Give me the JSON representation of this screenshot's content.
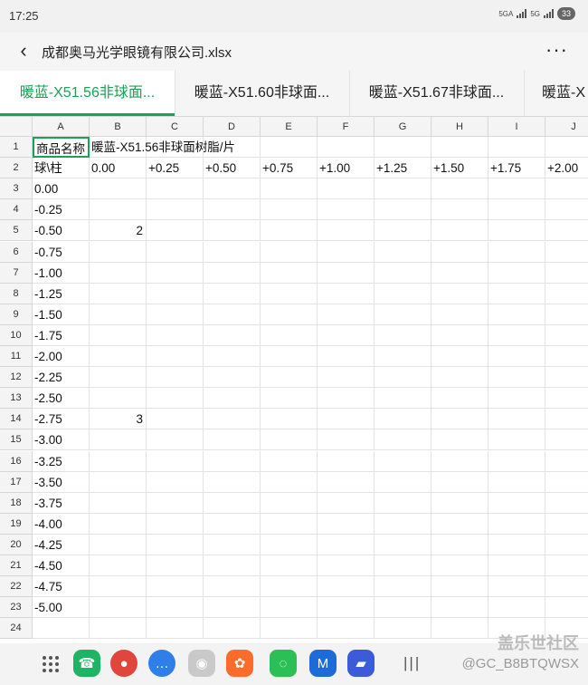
{
  "status": {
    "time": "17:25",
    "sig1": "5GA",
    "sig2": "5G",
    "battery": "33"
  },
  "header": {
    "back_icon": "‹",
    "title": "成都奥马光学眼镜有限公司.xlsx",
    "more_icon": "⋮"
  },
  "tabs": [
    {
      "label": "暖蓝-X51.56非球面..."
    },
    {
      "label": "暖蓝-X51.60非球面..."
    },
    {
      "label": "暖蓝-X51.67非球面..."
    },
    {
      "label": "暖蓝-X"
    }
  ],
  "columns": [
    "A",
    "B",
    "C",
    "D",
    "E",
    "F",
    "G",
    "H",
    "I",
    "J"
  ],
  "rows": [
    "1",
    "2",
    "3",
    "4",
    "5",
    "6",
    "7",
    "8",
    "9",
    "10",
    "11",
    "12",
    "13",
    "14",
    "15",
    "16",
    "17",
    "18",
    "19",
    "20",
    "21",
    "22",
    "23",
    "24"
  ],
  "cells": {
    "r1": {
      "a": "商品名称",
      "b": "暖蓝-X51.56非球面树脂/片"
    },
    "r2": [
      "球\\柱",
      "0.00",
      "+0.25",
      "+0.50",
      "+0.75",
      "+1.00",
      "+1.25",
      "+1.50",
      "+1.75",
      "+2.00"
    ],
    "colA": [
      "0.00",
      "-0.25",
      "-0.50",
      "-0.75",
      "-1.00",
      "-1.25",
      "-1.50",
      "-1.75",
      "-2.00",
      "-2.25",
      "-2.50",
      "-2.75",
      "-3.00",
      "-3.25",
      "-3.50",
      "-3.75",
      "-4.00",
      "-4.25",
      "-4.50",
      "-4.75",
      "-5.00"
    ],
    "b5": "2",
    "b14": "3"
  },
  "watermark": {
    "site": "盖乐世社区",
    "user": "@GC_B8BTQWSX"
  },
  "colors": {
    "accent": "#1aa355"
  }
}
